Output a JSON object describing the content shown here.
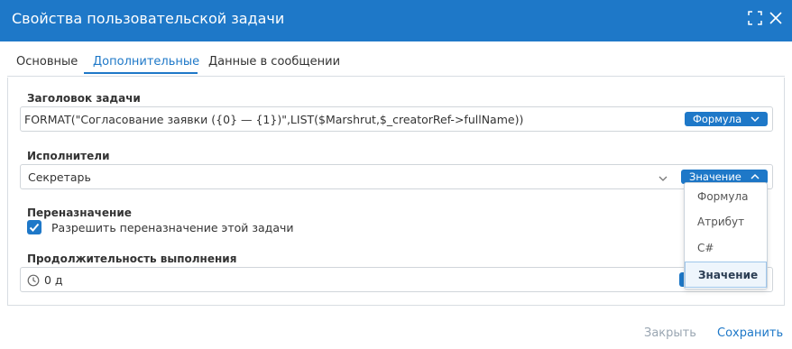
{
  "dialog": {
    "title": "Свойства пользовательской задачи"
  },
  "tabs": [
    {
      "label": "Основные"
    },
    {
      "label": "Дополнительные",
      "active": true
    },
    {
      "label": "Данные в сообщении"
    }
  ],
  "task_title": {
    "label": "Заголовок задачи",
    "value": "FORMAT(\"Согласование заявки ({0} — {1})\",LIST($Marshrut,$_creatorRef->fullName))",
    "mode_label": "Формула"
  },
  "executors": {
    "label": "Исполнители",
    "value": "Секретарь",
    "mode_label": "Значение"
  },
  "reassign": {
    "label": "Переназначение",
    "checkbox_label": "Разрешить переназначение этой задачи",
    "checked": true
  },
  "duration": {
    "label": "Продолжительность выполнения",
    "value": "0 д"
  },
  "mode_dropdown": {
    "options": [
      "Формула",
      "Атрибут",
      "C#",
      "Значение"
    ],
    "selected": "Значение"
  },
  "footer": {
    "close_label": "Закрыть",
    "save_label": "Сохранить"
  },
  "colors": {
    "accent": "#1e78c8",
    "disabled_text": "#9aa6b2"
  }
}
